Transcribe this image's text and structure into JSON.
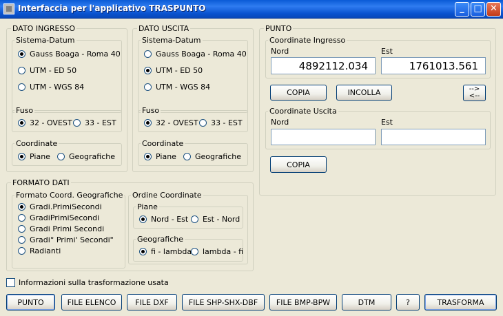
{
  "window": {
    "title": "Interfaccia per l'applicativo TRASPUNTO",
    "minimize": "_",
    "maximize": "□",
    "close": "✕"
  },
  "dato_ingresso": {
    "title": "DATO INGRESSO",
    "sistema_datum": {
      "title": "Sistema-Datum",
      "options": [
        "Gauss Boaga - Roma 40",
        "UTM - ED 50",
        "UTM - WGS 84"
      ],
      "selected": "Gauss Boaga - Roma 40"
    },
    "fuso": {
      "title": "Fuso",
      "options": [
        "32 - OVEST",
        "33 - EST"
      ],
      "selected": "32 - OVEST"
    },
    "coordinate": {
      "title": "Coordinate",
      "options": [
        "Piane",
        "Geografiche"
      ],
      "selected": "Piane"
    }
  },
  "dato_uscita": {
    "title": "DATO USCITA",
    "sistema_datum": {
      "title": "Sistema-Datum",
      "options": [
        "Gauss Boaga - Roma 40",
        "UTM - ED 50",
        "UTM - WGS 84"
      ],
      "selected": "UTM - ED 50"
    },
    "fuso": {
      "title": "Fuso",
      "options": [
        "32 - OVEST",
        "33 - EST"
      ],
      "selected": "32 - OVEST"
    },
    "coordinate": {
      "title": "Coordinate",
      "options": [
        "Piane",
        "Geografiche"
      ],
      "selected": "Piane"
    }
  },
  "formato_dati": {
    "title": "FORMATO DATI",
    "formato_coord": {
      "title": "Formato Coord. Geografiche",
      "options": [
        "Gradi.PrimiSecondi",
        "GradiPrimiSecondi",
        "Gradi Primi Secondi",
        "Gradi° Primi' Secondi\"",
        "Radianti"
      ],
      "selected": "Gradi.PrimiSecondi"
    },
    "ordine": {
      "title": "Ordine Coordinate",
      "piane": {
        "title": "Piane",
        "options": [
          "Nord - Est",
          "Est - Nord"
        ],
        "selected": "Nord - Est"
      },
      "geografiche": {
        "title": "Geografiche",
        "options": [
          "fi - lambda",
          "lambda - fi"
        ],
        "selected": "fi - lambda"
      }
    }
  },
  "punto": {
    "title": "PUNTO",
    "ingresso": {
      "title": "Coordinate Ingresso",
      "nord_label": "Nord",
      "est_label": "Est",
      "nord_value": "4892112.034",
      "est_value": "1761013.561"
    },
    "copia": "COPIA",
    "incolla": "INCOLLA",
    "swap_top": "-->",
    "swap_bottom": "<--",
    "uscita": {
      "title": "Coordinate Uscita",
      "nord_label": "Nord",
      "est_label": "Est",
      "nord_value": "",
      "est_value": ""
    },
    "copia_uscita": "COPIA"
  },
  "info_checkbox": "Informazioni sulla trasformazione usata",
  "bottom_buttons": {
    "punto": "PUNTO",
    "file_elenco": "FILE ELENCO",
    "file_dxf": "FILE DXF",
    "file_shp": "FILE SHP-SHX-DBF",
    "file_bmp": "FILE BMP-BPW",
    "dtm": "DTM",
    "help": "?",
    "trasforma": "TRASFORMA"
  }
}
